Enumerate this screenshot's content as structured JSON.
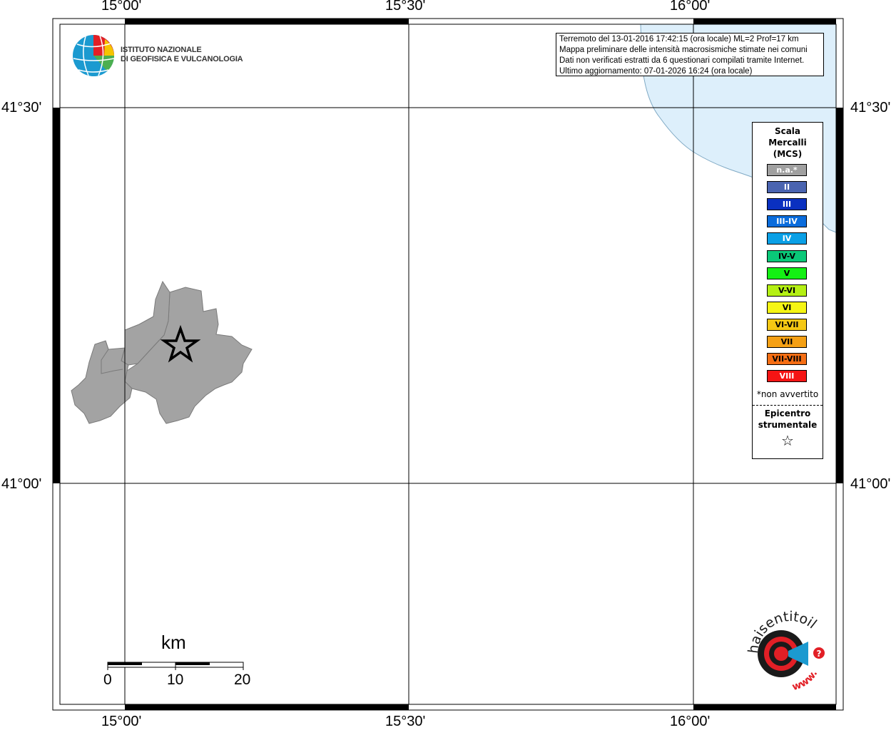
{
  "map": {
    "top_lon_labels": [
      "15°00'",
      "15°30'",
      "16°00'"
    ],
    "bottom_lon_labels": [
      "15°00'",
      "15°30'",
      "16°00'"
    ],
    "left_lat_labels": [
      "41°30'",
      "41°00'"
    ],
    "right_lat_labels": [
      "41°30'",
      "41°00'"
    ]
  },
  "info_box": {
    "lines": [
      "Terremoto del 13-01-2016 17:42:15 (ora locale) ML=2 Prof=17 km",
      "Mappa preliminare delle intensità macrosismiche stimate nei comuni",
      "Dati non verificati estratti da 6 questionari compilati tramite Internet.",
      "Ultimo aggiornamento: 07-01-2026 16:24 (ora locale)"
    ]
  },
  "institute": {
    "line1": "ISTITUTO NAZIONALE",
    "line2": "DI GEOFISICA E VULCANOLOGIA"
  },
  "legend": {
    "title_lines": [
      "Scala",
      "Mercalli",
      "(MCS)"
    ],
    "items": [
      {
        "label": "n.a.*",
        "color": "#a0a0a0",
        "text_color": "#ffffff"
      },
      {
        "label": "II",
        "color": "#4a64b0",
        "text_color": "#ffffff"
      },
      {
        "label": "III",
        "color": "#0a30c0",
        "text_color": "#ffffff"
      },
      {
        "label": "III-IV",
        "color": "#0a6cdc",
        "text_color": "#ffffff"
      },
      {
        "label": "IV",
        "color": "#0aa0e6",
        "text_color": "#ffffff"
      },
      {
        "label": "IV-V",
        "color": "#0ac878",
        "text_color": "#000000"
      },
      {
        "label": "V",
        "color": "#14f014",
        "text_color": "#000000"
      },
      {
        "label": "V-VI",
        "color": "#b4f014",
        "text_color": "#000000"
      },
      {
        "label": "VI",
        "color": "#f5f514",
        "text_color": "#000000"
      },
      {
        "label": "VI-VII",
        "color": "#f5c814",
        "text_color": "#000000"
      },
      {
        "label": "VII",
        "color": "#f5a014",
        "text_color": "#000000"
      },
      {
        "label": "VII-VIII",
        "color": "#f56e14",
        "text_color": "#000000"
      },
      {
        "label": "VIII",
        "color": "#f51414",
        "text_color": "#ffffff"
      }
    ],
    "note": "*non avvertito",
    "epicenter_lines": [
      "Epicentro",
      "strumentale"
    ],
    "epicenter_symbol": "☆"
  },
  "scale_bar": {
    "unit": "km",
    "ticks": [
      "0",
      "10",
      "20"
    ]
  },
  "haisentito_logo": {
    "text": "haisentitoilterremoto.it",
    "www": "www."
  },
  "colors": {
    "sea": "#ddeffb",
    "felt_area": "#a3a3a3",
    "frame": "#000000"
  }
}
